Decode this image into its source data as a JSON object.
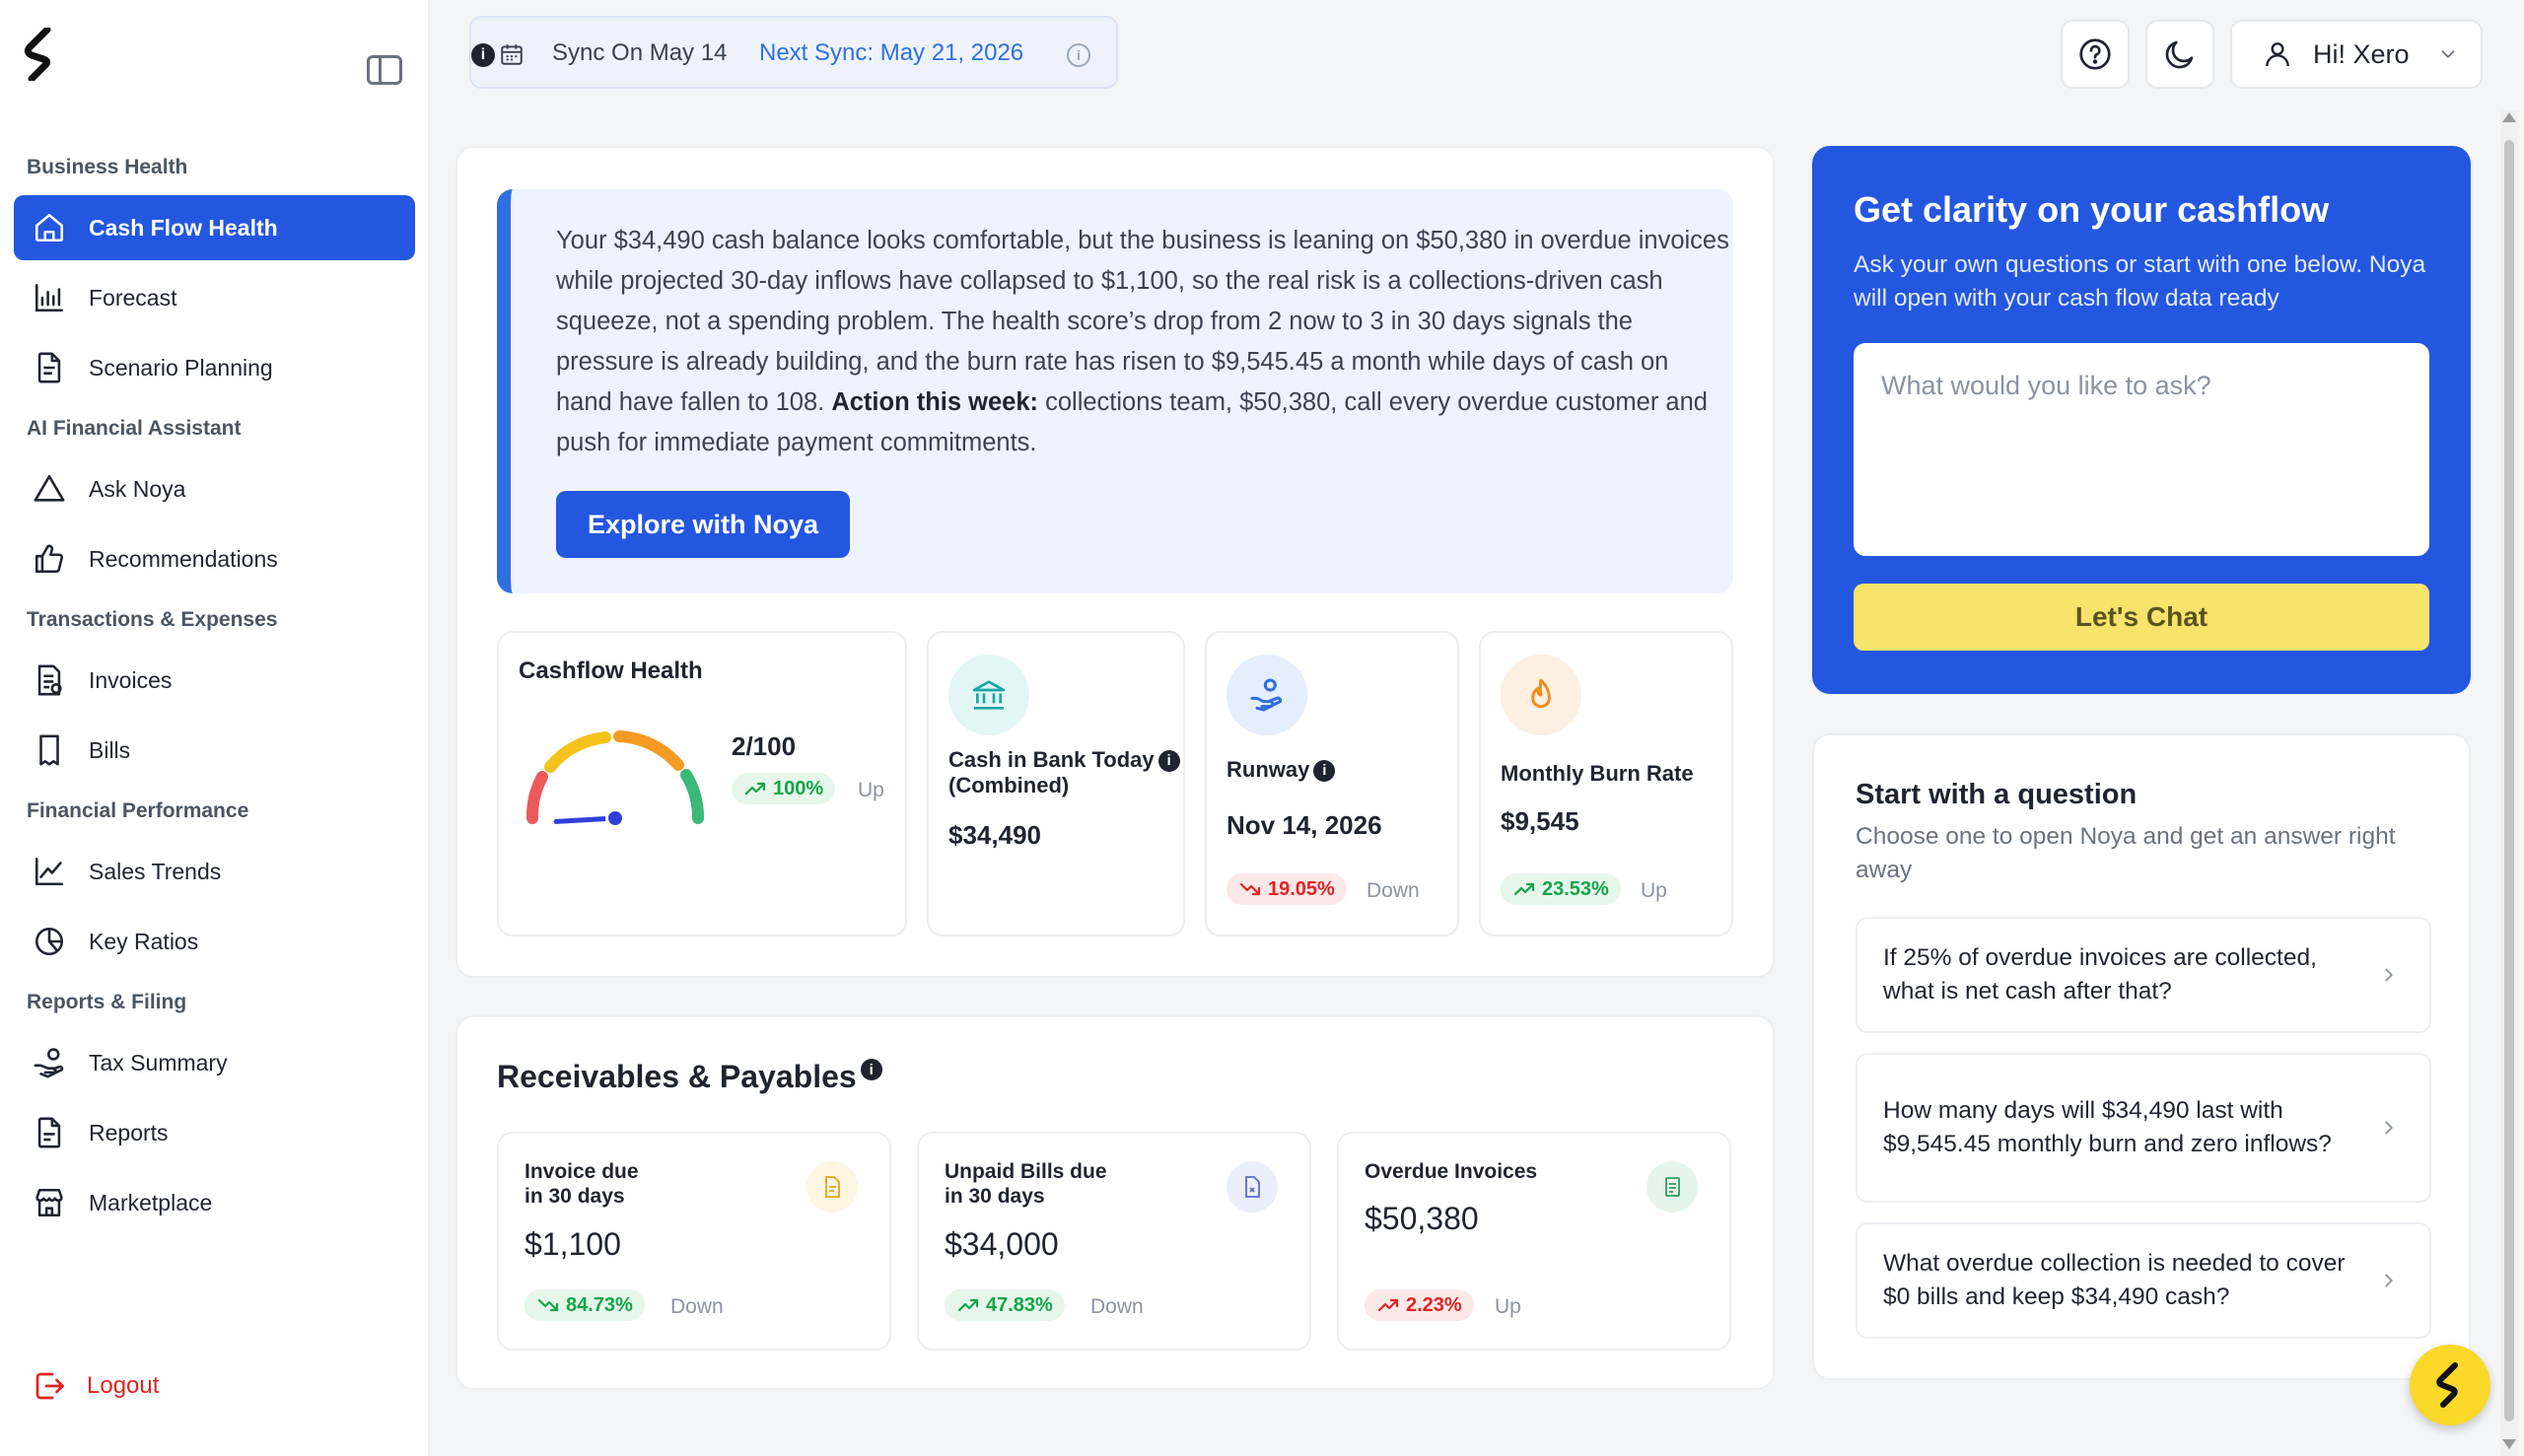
{
  "sidebar": {
    "sections": [
      {
        "label": "Business Health"
      },
      {
        "label": "AI Financial Assistant"
      },
      {
        "label": "Transactions & Expenses"
      },
      {
        "label": "Financial Performance"
      },
      {
        "label": "Reports & Filing"
      }
    ],
    "items": [
      {
        "label": "Cash Flow Health",
        "icon": "home-icon",
        "active": true
      },
      {
        "label": "Forecast",
        "icon": "bar-chart-icon"
      },
      {
        "label": "Scenario Planning",
        "icon": "document-icon"
      },
      {
        "label": "Ask Noya",
        "icon": "triangle-icon"
      },
      {
        "label": "Recommendations",
        "icon": "thumbs-up-icon"
      },
      {
        "label": "Invoices",
        "icon": "invoice-icon"
      },
      {
        "label": "Bills",
        "icon": "bill-icon"
      },
      {
        "label": "Sales Trends",
        "icon": "line-chart-icon"
      },
      {
        "label": "Key Ratios",
        "icon": "pie-chart-icon"
      },
      {
        "label": "Tax Summary",
        "icon": "hand-coin-icon"
      },
      {
        "label": "Reports",
        "icon": "report-icon"
      },
      {
        "label": "Marketplace",
        "icon": "store-icon"
      }
    ],
    "logout_label": "Logout"
  },
  "topbar": {
    "sync_on": "Sync On May 14",
    "next_sync": "Next Sync: May 21, 2026",
    "user_greeting": "Hi! Xero"
  },
  "summary": {
    "text_part1": "Your $34,490 cash balance looks comfortable, but the business is leaning on $50,380 in overdue invoices while projected 30-day inflows have collapsed to $1,100, so the real risk is a collections-driven cash squeeze, not a spending problem. The health score’s drop from 2 now to 3 in 30 days signals the pressure is already building, and the burn rate has risen to $9,545.45 a month while days of cash on hand have fallen to 108. ",
    "text_bold": "Action this week:",
    "text_part2": " collections team, $50,380, call every overdue customer and push for immediate payment commitments.",
    "explore_label": "Explore with Noya"
  },
  "metrics": {
    "cashflow_health": {
      "title": "Cashflow Health",
      "score": "2/100",
      "gauge_score": 2,
      "gauge_max": 100,
      "change": "100%",
      "trend": "Up"
    },
    "cash_in_bank": {
      "title_line1": "Cash in Bank Today",
      "title_line2": "(Combined)",
      "value": "$34,490"
    },
    "runway": {
      "title": "Runway",
      "value": "Nov 14, 2026",
      "change": "19.05%",
      "trend": "Down"
    },
    "burn_rate": {
      "title": "Monthly Burn Rate",
      "value": "$9,545",
      "change": "23.53%",
      "trend": "Up"
    }
  },
  "receivables": {
    "title": "Receivables & Payables",
    "items": [
      {
        "title_line1": "Invoice due",
        "title_line2": "in 30 days",
        "value": "$1,100",
        "change": "84.73%",
        "trend": "Down",
        "pill": "green"
      },
      {
        "title_line1": "Unpaid Bills due",
        "title_line2": "in 30 days",
        "value": "$34,000",
        "change": "47.83%",
        "trend": "Down",
        "pill": "green"
      },
      {
        "title_line1": "Overdue Invoices",
        "title_line2": "",
        "value": "$50,380",
        "change": "2.23%",
        "trend": "Up",
        "pill": "red"
      }
    ]
  },
  "chat": {
    "title": "Get clarity on your cashflow",
    "subtitle": "Ask your own questions or start with one below. Noya will open with your cash flow data ready",
    "placeholder": "What would you like to ask?",
    "button_label": "Let's Chat"
  },
  "questions": {
    "title": "Start with a question",
    "subtitle": "Choose one to open Noya and get an answer right away",
    "items": [
      "If 25% of overdue invoices are collected, what is net cash after that?",
      "How many days will $34,490 last with $9,545.45 monthly burn and zero inflows?",
      "What overdue collection is needed to cover $0 bills and keep $34,490 cash?"
    ]
  },
  "colors": {
    "primary": "#2457e0",
    "accent_yellow": "#f8e36b",
    "positive": "#16a34a",
    "negative": "#e02424"
  }
}
